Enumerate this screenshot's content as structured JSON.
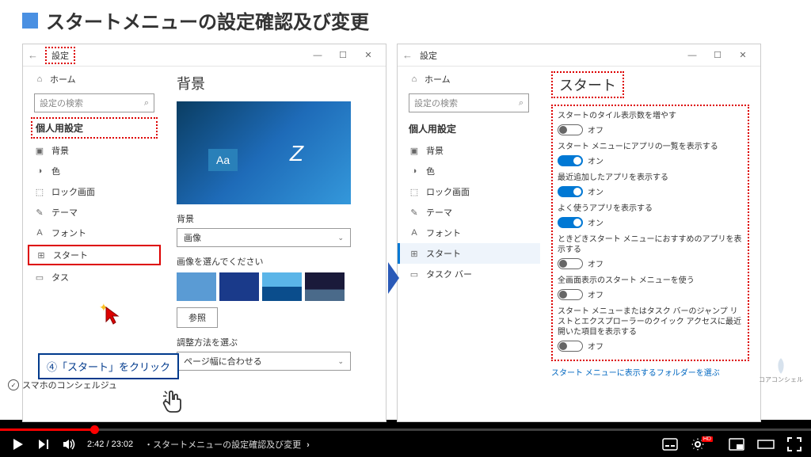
{
  "slide": {
    "title": "スタートメニューの設定確認及び変更"
  },
  "panel_left": {
    "title": "設定",
    "home": "ホーム",
    "search_placeholder": "設定の検索",
    "section": "個人用設定",
    "nav": [
      {
        "label": "背景"
      },
      {
        "label": "色"
      },
      {
        "label": "ロック画面"
      },
      {
        "label": "テーマ"
      },
      {
        "label": "フォント"
      },
      {
        "label": "スタート"
      },
      {
        "label": "タス"
      }
    ],
    "main_heading": "背景",
    "bg_label": "背景",
    "bg_dropdown": "画像",
    "choose_label": "画像を選んでください",
    "browse": "参照",
    "fit_label": "調整方法を選ぶ",
    "fit_dropdown": "ページ幅に合わせる"
  },
  "panel_right": {
    "title": "設定",
    "home": "ホーム",
    "search_placeholder": "設定の検索",
    "section": "個人用設定",
    "nav": [
      {
        "label": "背景"
      },
      {
        "label": "色"
      },
      {
        "label": "ロック画面"
      },
      {
        "label": "テーマ"
      },
      {
        "label": "フォント"
      },
      {
        "label": "スタート"
      },
      {
        "label": "タスク バー"
      }
    ],
    "main_heading": "スタート",
    "toggles": [
      {
        "label": "スタートのタイル表示数を増やす",
        "state": "オフ",
        "on": false
      },
      {
        "label": "スタート メニューにアプリの一覧を表示する",
        "state": "オン",
        "on": true
      },
      {
        "label": "最近追加したアプリを表示する",
        "state": "オン",
        "on": true
      },
      {
        "label": "よく使うアプリを表示する",
        "state": "オン",
        "on": true
      },
      {
        "label": "ときどきスタート メニューにおすすめのアプリを表示する",
        "state": "オフ",
        "on": false
      },
      {
        "label": "全画面表示のスタート メニューを使う",
        "state": "オフ",
        "on": false
      },
      {
        "label": "スタート メニューまたはタスク バーのジャンプ リストとエクスプローラーのクイック アクセスに最近開いた項目を表示する",
        "state": "オフ",
        "on": false
      }
    ],
    "link": "スタート メニューに表示するフォルダーを選ぶ"
  },
  "callout": {
    "text": "④「スタート」をクリック"
  },
  "watermark": {
    "label": "コアコンシェル"
  },
  "bottom_logo": "スマホのコンシェルジュ",
  "player": {
    "time": "2:42 / 23:02",
    "chapter": "・スタートメニューの設定確認及び変更",
    "chevron": "›"
  }
}
